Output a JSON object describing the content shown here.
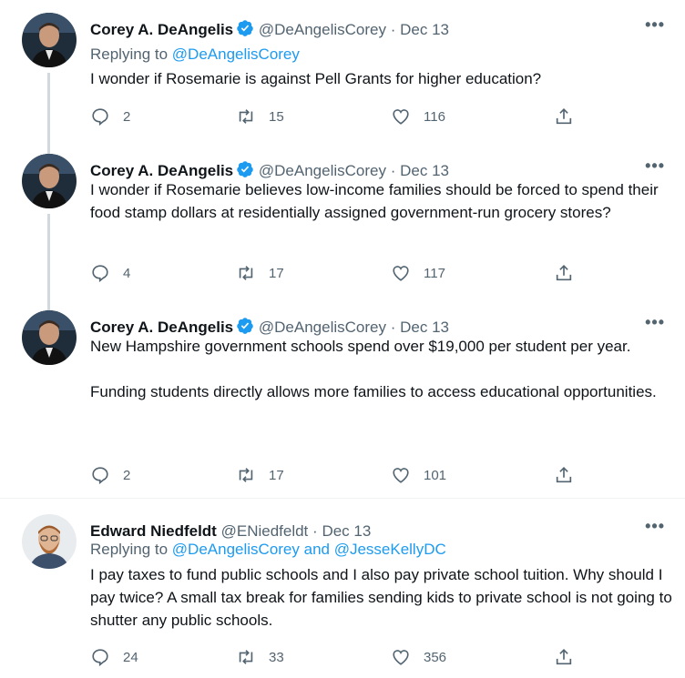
{
  "tweets": [
    {
      "name": "Corey A. DeAngelis",
      "handle": "@DeAngelisCorey",
      "date": "Dec 13",
      "replying_prefix": "Replying to",
      "replying_to": "@DeAngelisCorey",
      "text": [
        "I wonder if Rosemarie is against Pell Grants for higher education?"
      ],
      "replies": "2",
      "retweets": "15",
      "likes": "116"
    },
    {
      "name": "Corey A. DeAngelis",
      "handle": "@DeAngelisCorey",
      "date": "Dec 13",
      "text": [
        "I wonder if Rosemarie believes low-income families should be forced to spend their food stamp dollars at residentially assigned government-run grocery stores?"
      ],
      "replies": "4",
      "retweets": "17",
      "likes": "117"
    },
    {
      "name": "Corey A. DeAngelis",
      "handle": "@DeAngelisCorey",
      "date": "Dec 13",
      "text": [
        "New Hampshire government schools spend over $19,000 per student per year.",
        "Funding students directly allows more families to access educational opportunities."
      ],
      "replies": "2",
      "retweets": "17",
      "likes": "101"
    },
    {
      "name": "Edward Niedfeldt",
      "handle": "@ENiedfeldt",
      "date": "Dec 13",
      "replying_prefix": "Replying to",
      "replying_to": "@DeAngelisCorey and @JesseKellyDC",
      "text": [
        "I pay taxes to fund public schools and I also pay private school tuition.  Why should I pay twice?  A small tax break for families sending kids to private school is not going to shutter any public schools."
      ],
      "replies": "24",
      "retweets": "33",
      "likes": "356"
    }
  ],
  "separator": "·",
  "more_glyph": "•••",
  "colors": {
    "link": "#1d9bf0",
    "verified": "#1d9bf0",
    "muted": "#536471",
    "text": "#0f1419"
  },
  "icons": [
    "verified-badge-icon",
    "more-icon",
    "reply-icon",
    "retweet-icon",
    "like-icon",
    "share-icon"
  ]
}
